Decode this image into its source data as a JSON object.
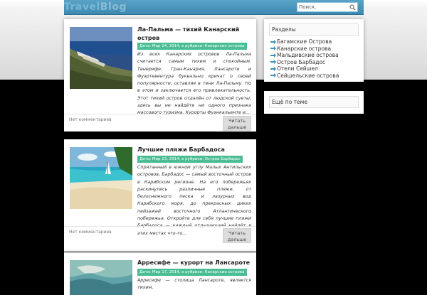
{
  "header": {
    "logo_part1": "Travel",
    "logo_part2": "Blog",
    "search_value": "Поиск."
  },
  "posts": [
    {
      "title": "Ла-Пальма — тихий Канарский остров",
      "meta": "Дата: Мар 24, 2014, в рубрике: Канарские острова",
      "excerpt": "Из всех Канарских островов Ла-Пальма считается самым тихим и спокойным. Тенерифе, Гран-Канария, Лансароте и Фуэртевентура буквально кричат о своей популярности, оставляя в тени Ла-Пальму. Но в этом и заключается его привлекательность. Этот тихий остров отдалён от людской суеты, здесь вы не найдёте ни одного признака массового туризма. Курорты Фуэнкальенте и...",
      "comments": "Нет комментариев",
      "read_more": "Читать дальше"
    },
    {
      "title": "Лучшие пляжи Барбадоса",
      "meta": "Дата: Мар 23, 2014, в рубрике: Остров Барбадос",
      "excerpt": "Спрятанный в южном углу Малых Антильских островов, Барбадос — самый восточный остров в Карибском регионе. На его побережьях раскинулись различные пляжи, от белоснежного песка и лазурных вод Карибского моря, до прекрасных диких пейзажей восточного Атлантического побережья. Откройте для себя лучшие пляжи Барбадоса — каждый отдыхающий найдёт в этих местах что-то...",
      "comments": "Нет комментариев",
      "read_more": "Читать дальше"
    },
    {
      "title": "Арресифе — курорт на Лансароте",
      "meta": "Дата: Мар 17, 2014, в рубрике: Канарские острова",
      "excerpt": "Арресифе — столица Лансароте, является тихим,"
    }
  ],
  "sidebar": {
    "categories_title": "Разделы",
    "categories": [
      "Багамские Острова",
      "Канарские острова",
      "Мальдивские острова",
      "Остров Барбадос",
      "Отели Сейшел",
      "Сейшельские острова"
    ],
    "more_title": "Ещё по теме"
  },
  "colors": {
    "header": "#3d89b0",
    "meta_badge": "#4bbd94",
    "arrow": "#3d8fc0"
  }
}
